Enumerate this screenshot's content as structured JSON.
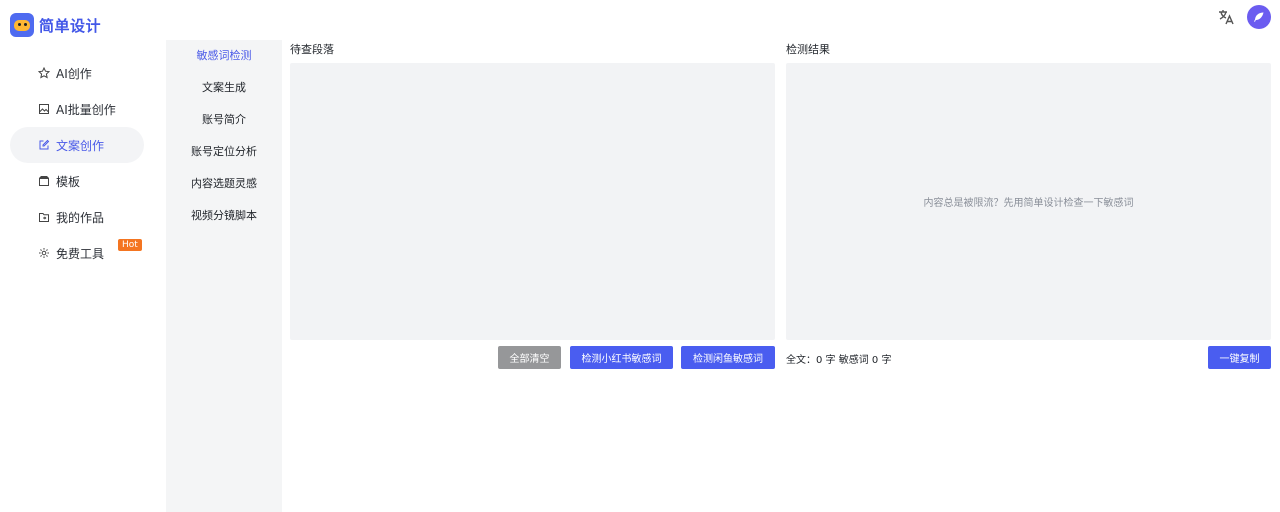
{
  "app": {
    "name": "简单设计"
  },
  "sidebar": {
    "items": [
      {
        "label": "AI创作",
        "icon": "star-icon"
      },
      {
        "label": "AI批量创作",
        "icon": "image-icon"
      },
      {
        "label": "文案创作",
        "icon": "edit-icon"
      },
      {
        "label": "模板",
        "icon": "template-icon"
      },
      {
        "label": "我的作品",
        "icon": "folder-icon"
      },
      {
        "label": "免费工具",
        "icon": "settings-icon",
        "badge": "Hot"
      }
    ],
    "active_index": 2
  },
  "subnav": {
    "items": [
      "敏感词检测",
      "文案生成",
      "账号简介",
      "账号定位分析",
      "内容选题灵感",
      "视频分镜脚本"
    ],
    "active_index": 0
  },
  "input_panel": {
    "title": "待查段落",
    "value": "",
    "buttons": {
      "clear": "全部清空",
      "check_xhs": "检测小红书敏感词",
      "check_xianyu": "检测闲鱼敏感词"
    }
  },
  "result_panel": {
    "title": "检测结果",
    "placeholder": "内容总是被限流？先用简单设计检查一下敏感词",
    "stats": "全文：0 字 敏感词 0 字",
    "copy_button": "一键复制"
  },
  "colors": {
    "accent": "#4a5df0",
    "brand": "#4257e8",
    "hot": "#f47521",
    "panel_bg": "#f2f3f5",
    "gray_button": "#969799"
  }
}
